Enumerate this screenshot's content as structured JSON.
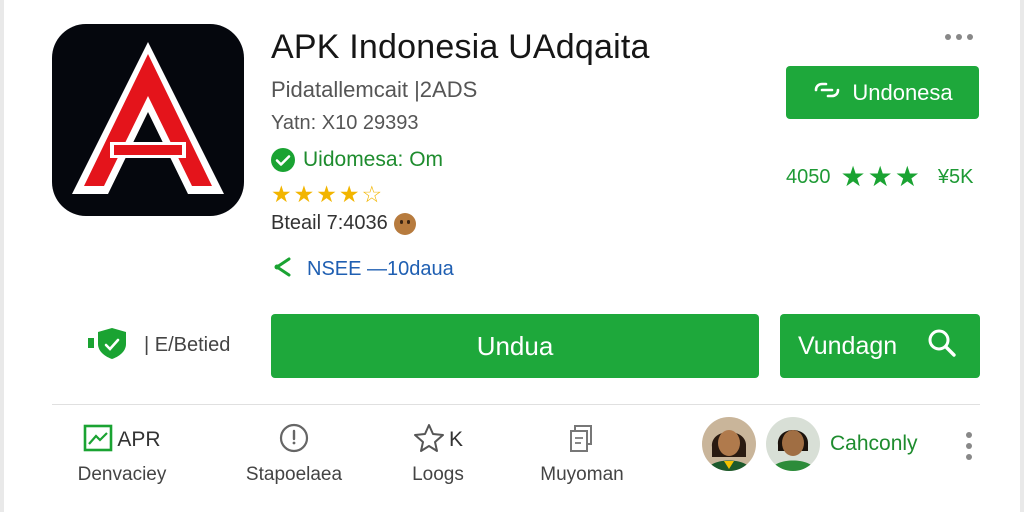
{
  "app": {
    "title": "APK Indonesia UAdqaita",
    "developer": "Pidatallemcait |2ADS",
    "version": "Yatn: X10 29393",
    "verified_label": "Uidomesa: Om",
    "rating_stars": 4,
    "rating_max": 5,
    "detail_label": "Bteail 7:4036",
    "share_label": "NSEE —10daua"
  },
  "header_actions": {
    "install_button": "Undonesa",
    "more_icon": "more-horizontal-icon"
  },
  "stats": {
    "count": "4050",
    "stars": 3,
    "size": "¥5K"
  },
  "badge": {
    "label": "| E/Betied"
  },
  "actions": {
    "primary_button": "Undua",
    "secondary_button": "Vundagn"
  },
  "tabs": [
    {
      "head": "APR",
      "label": "Denvaciey",
      "icon": "image-icon"
    },
    {
      "head": "",
      "label": "Stapoelaea",
      "icon": "clock-icon"
    },
    {
      "head": "K",
      "label": "Loogs",
      "icon": "star-icon"
    },
    {
      "head": "",
      "label": "Muyoman",
      "icon": "copy-icon"
    }
  ],
  "community": {
    "label": "Cahconly"
  },
  "colors": {
    "accent": "#1ea83b",
    "icon_bg": "#05070d",
    "icon_red": "#e4141b",
    "star_gold": "#f2b500",
    "link_blue": "#1f5fb2"
  }
}
